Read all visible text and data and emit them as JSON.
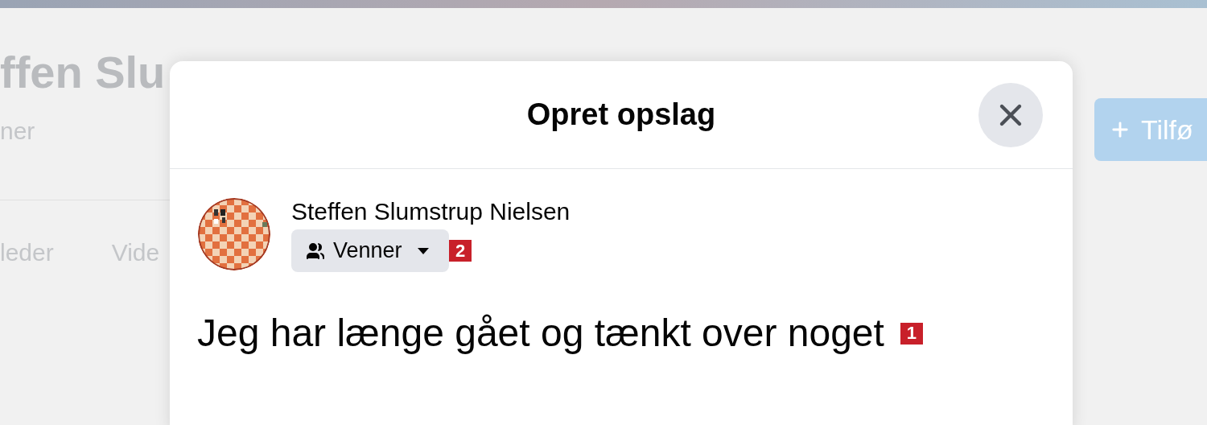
{
  "background_page": {
    "profile_name": "ffen Slu",
    "subtitle": "ner",
    "tabs": [
      {
        "label": "leder"
      },
      {
        "label": "Vide"
      }
    ],
    "add_button": {
      "label": "Tilfø"
    }
  },
  "dialog": {
    "title": "Opret opslag",
    "author": {
      "name": "Steffen Slumstrup Nielsen"
    },
    "audience": {
      "label": "Venner"
    },
    "post_text": "Jeg har længe gået og tænkt over noget",
    "annotations": [
      {
        "label": "1"
      },
      {
        "label": "2"
      }
    ]
  }
}
